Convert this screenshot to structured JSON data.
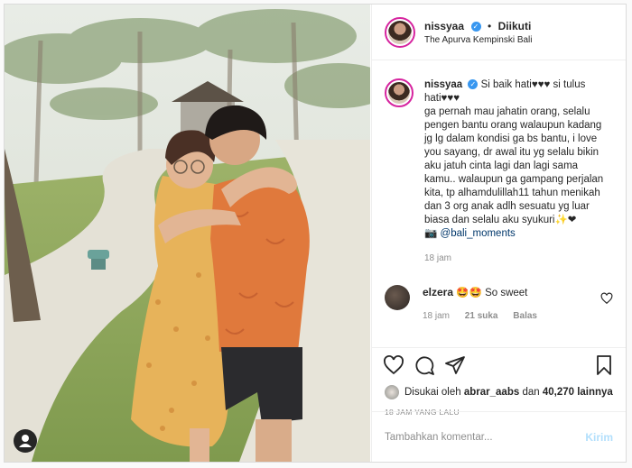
{
  "header": {
    "username": "nissyaa",
    "separator": "•",
    "follow_state": "Diikuti",
    "location": "The Apurva Kempinski Bali"
  },
  "caption": {
    "username": "nissyaa",
    "text": "Si baik hati♥♥♥ si tulus hati♥♥♥\nga pernah mau jahatin orang, selalu pengen bantu orang walaupun kadang jg lg dalam kondisi ga bs bantu, i love you sayang, dr awal itu yg selalu bikin aku jatuh cinta lagi dan lagi sama kamu.. walaupun ga gampang perjalan kita, tp alhamdulillah11 tahun menikah dan 3 org anak adlh sesuatu yg luar biasa dan selalu aku syukuri",
    "emoji_tail": "✨❤",
    "camera_emoji": "📷",
    "mention": "@bali_moments",
    "time": "18 jam"
  },
  "comment": {
    "username": "elzera",
    "text": "🤩🤩 So sweet",
    "time": "18 jam",
    "likes": "21 suka",
    "reply": "Balas"
  },
  "likes": {
    "prefix": "Disukai oleh",
    "user": "abrar_aabs",
    "middle": "dan",
    "count": "40,270 lainnya"
  },
  "posted_ago": "18 JAM YANG LALU",
  "add_comment": {
    "placeholder": "Tambahkan komentar...",
    "post_label": "Kirim"
  },
  "icons": [
    "heart-icon",
    "comment-icon",
    "share-icon",
    "bookmark-icon",
    "user-tag-icon",
    "verified-icon"
  ],
  "colors": {
    "verified": "#3897f0",
    "story_ring": "#d6249f",
    "post_disabled": "#b2dffc",
    "muted": "#8e8e8e"
  }
}
